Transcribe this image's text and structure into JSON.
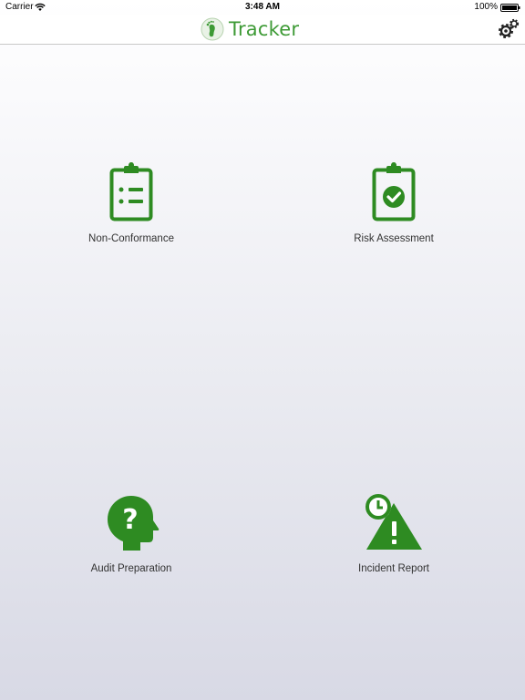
{
  "status_bar": {
    "carrier": "Carrier",
    "time": "3:48 AM",
    "battery": "100%",
    "icons": [
      "wifi-icon",
      "battery-icon"
    ]
  },
  "nav": {
    "title": "Tracker",
    "logo_icon": "footprint-logo-icon",
    "settings_icon": "gear-icon"
  },
  "tiles": [
    {
      "label": "Non-Conformance",
      "icon": "clipboard-list-icon"
    },
    {
      "label": "Risk Assessment",
      "icon": "clipboard-check-icon"
    },
    {
      "label": "Audit Preparation",
      "icon": "head-question-icon"
    },
    {
      "label": "Incident Report",
      "icon": "clock-warning-icon"
    }
  ],
  "colors": {
    "accent": "#2e8b22",
    "title": "#3d9a35"
  }
}
